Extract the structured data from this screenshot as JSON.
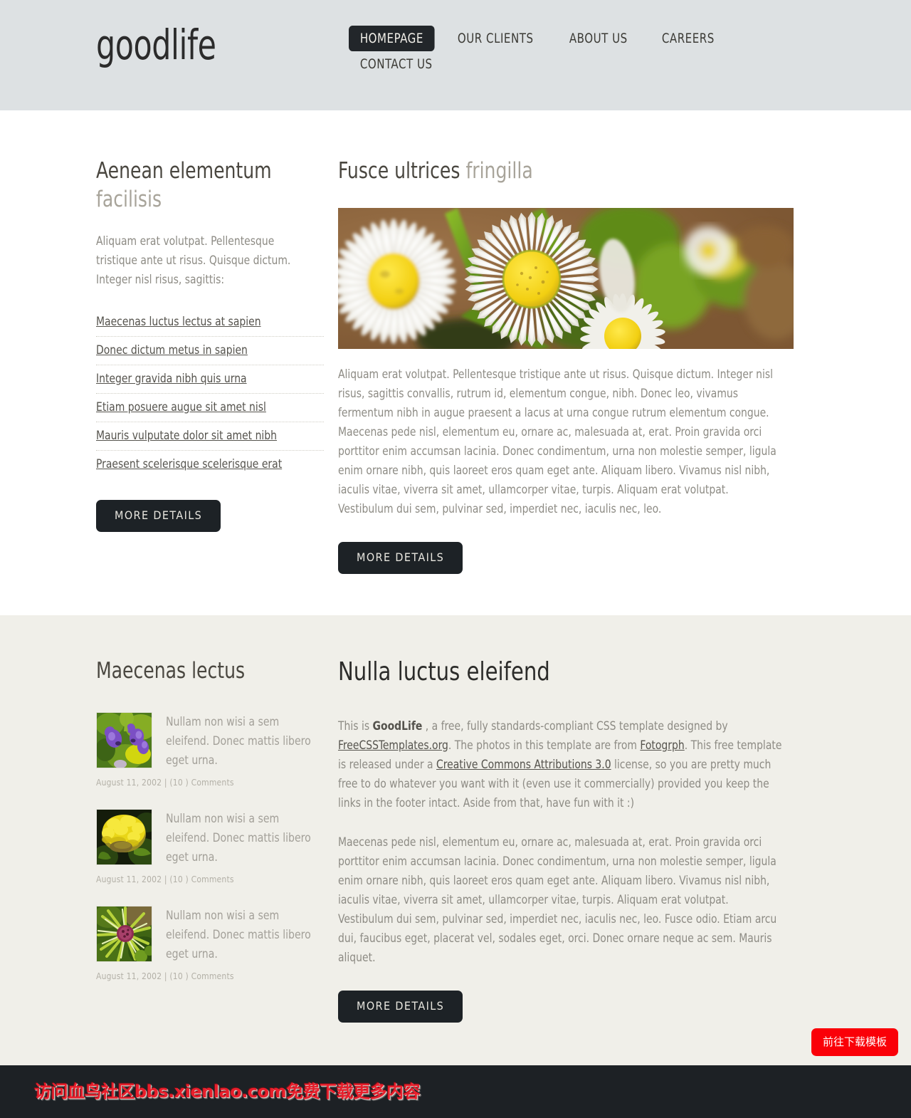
{
  "header": {
    "logo": "goodlife",
    "nav": [
      {
        "label": "HOMEPAGE",
        "active": true
      },
      {
        "label": "OUR CLIENTS",
        "active": false
      },
      {
        "label": "ABOUT US",
        "active": false
      },
      {
        "label": "CAREERS",
        "active": false
      },
      {
        "label": "CONTACT US",
        "active": false
      }
    ]
  },
  "section_one": {
    "left": {
      "title_strong": "Aenean elementum",
      "title_muted": "facilisis",
      "intro": "Aliquam erat volutpat. Pellentesque tristique ante ut risus. Quisque dictum. Integer nisl risus, sagittis:",
      "links": [
        "Maecenas luctus lectus at sapien",
        "Donec dictum metus in sapien",
        "Integer gravida nibh quis urna",
        "Etiam posuere augue sit amet nisl",
        "Mauris vulputate dolor sit amet nibh",
        "Praesent scelerisque scelerisque erat"
      ],
      "button": "MORE DETAILS"
    },
    "right": {
      "title_strong": "Fusce ultrices",
      "title_muted": "fringilla",
      "image_alt": "daisy-flowers-photo",
      "body": "Aliquam erat volutpat. Pellentesque tristique ante ut risus. Quisque dictum. Integer nisl risus, sagittis convallis, rutrum id, elementum congue, nibh. Donec leo, vivamus fermentum nibh in augue praesent a lacus at urna congue rutrum elementum congue. Maecenas pede nisl, elementum eu, ornare ac, malesuada at, erat. Proin gravida orci porttitor enim accumsan lacinia. Donec condimentum, urna non molestie semper, ligula enim ornare nibh, quis laoreet eros quam eget ante. Aliquam libero. Vivamus nisl nibh, iaculis vitae, viverra sit amet, ullamcorper vitae, turpis. Aliquam erat volutpat. Vestibulum dui sem, pulvinar sed, imperdiet nec, iaculis nec, leo.",
      "button": "MORE DETAILS"
    }
  },
  "section_two": {
    "left": {
      "title": "Maecenas lectus",
      "posts": [
        {
          "thumb": "purple-flowers-thumb",
          "text": "Nullam non wisi a sem eleifend. Donec mattis libero eget urna.",
          "meta": "August 11, 2002 | (10 ) Comments"
        },
        {
          "thumb": "yellow-marigold-thumb",
          "text": "Nullam non wisi a sem eleifend. Donec mattis libero eget urna.",
          "meta": "August 11, 2002 | (10 ) Comments"
        },
        {
          "thumb": "green-thistle-thumb",
          "text": "Nullam non wisi a sem eleifend. Donec mattis libero eget urna.",
          "meta": "August 11, 2002 | (10 ) Comments"
        }
      ]
    },
    "right": {
      "title": "Nulla luctus eleifend",
      "para1_a": "This is ",
      "para1_brand": "GoodLife",
      "para1_b": " , a free, fully standards-compliant CSS template designed by ",
      "para1_link1": "FreeCSSTemplates.org",
      "para1_c": ". The photos in this template are from ",
      "para1_link2": "Fotogrph",
      "para1_d": ". This free template is released under a ",
      "para1_link3": "Creative Commons Attributions 3.0",
      "para1_e": " license, so you are pretty much free to do whatever you want with it (even use it commercially) provided you keep the links in the footer intact. Aside from that, have fun with it :)",
      "para2": "Maecenas pede nisl, elementum eu, ornare ac, malesuada at, erat. Proin gravida orci porttitor enim accumsan lacinia. Donec condimentum, urna non molestie semper, ligula enim ornare nibh, quis laoreet eros quam eget ante. Aliquam libero. Vivamus nisl nibh, iaculis vitae, viverra sit amet, ullamcorper vitae, turpis. Aliquam erat volutpat. Vestibulum dui sem, pulvinar sed, imperdiet nec, iaculis nec, leo. Fusce odio. Etiam arcu dui, faucibus eget, placerat vel, sodales eget, orci. Donec ornare neque ac sem. Mauris aliquet.",
      "button": "MORE DETAILS"
    }
  },
  "footer": {
    "watermark": "访问血鸟社区bbs.xienlao.com免费下载更多内容",
    "download_button": "前往下载模板"
  },
  "colors": {
    "header_bg": "#dde1e3",
    "beige_bg": "#f0efe9",
    "button_dark": "#1d2226",
    "footer_bg": "#1d2125",
    "accent_red": "#fa0008"
  }
}
